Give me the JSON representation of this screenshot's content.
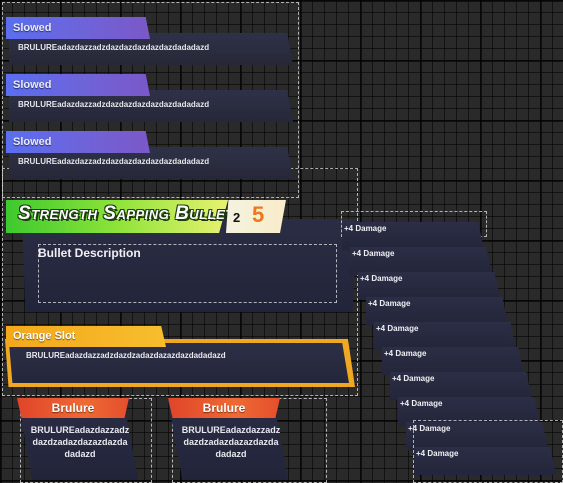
{
  "status_effects": [
    {
      "label": "Slowed",
      "text": "BRULUREadazdazzadzdazdazdazdazdazdadadazd"
    },
    {
      "label": "Slowed",
      "text": "BRULUREadazdazzadzdazdazdazdazdazdadadazd"
    },
    {
      "label": "Slowed",
      "text": "BRULUREadazdazzadzdazdazdazdazdazdadadazd"
    }
  ],
  "item": {
    "title": "Strength Sapping Bullet",
    "cost_small": "2",
    "cost_big": "5",
    "description_title": "Bullet Description"
  },
  "orange_slot": {
    "label": "Orange Slot",
    "text": "BRULUREadazdazzadzdazdzadazdazazdazdadadazd"
  },
  "brulure_cards": [
    {
      "label": "Brulure",
      "text": "BRULUREadazdazzadzdazdzadazdazazdazdadadazd"
    },
    {
      "label": "Brulure",
      "text": "BRULUREadazdazzadzdazdzadazdazazdazdadadazd"
    }
  ],
  "damage_list": [
    "+4 Damage",
    "+4 Damage",
    "+4 Damage",
    "+4 Damage",
    "+4 Damage",
    "+4 Damage",
    "+4 Damage",
    "+4 Damage",
    "+4 Damage",
    "+4 Damage"
  ],
  "colors": {
    "status_tab": "#5a6ef0",
    "title_green": "#8ee339",
    "cost_orange": "#f0761d",
    "orange_slot": "#f3a81c",
    "brulure_red": "#e0442a",
    "panel_dark": "#2b2d44"
  }
}
